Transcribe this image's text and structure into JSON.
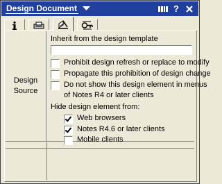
{
  "window": {
    "title": "Design Document",
    "help_label": "?",
    "close_label": "X"
  },
  "tabs": [
    {
      "name": "info",
      "icon": "info-icon",
      "label": "i"
    },
    {
      "name": "printer",
      "icon": "printer-icon"
    },
    {
      "name": "design",
      "icon": "design-icon",
      "active": true
    },
    {
      "name": "key",
      "icon": "key-icon"
    }
  ],
  "section": {
    "label_line1": "Design",
    "label_line2": "Source",
    "inherit_label": "Inherit from the design template",
    "inherit_value": "",
    "options": [
      {
        "text": "Prohibit design refresh or replace to modify",
        "checked": false
      },
      {
        "text": "Propagate this prohibition of design change",
        "checked": false
      },
      {
        "text": "Do not show this design element in menus",
        "text2": "of Notes R4 or later clients",
        "checked": false
      }
    ],
    "hide_label": "Hide design element from:",
    "hide_options": [
      {
        "text": "Web browsers",
        "checked": true
      },
      {
        "text": "Notes R4.6 or later clients",
        "checked": true
      },
      {
        "text": "Mobile clients",
        "checked": false
      }
    ]
  },
  "colors": {
    "titlebar": "#21409e",
    "background": "#ece9d8"
  }
}
